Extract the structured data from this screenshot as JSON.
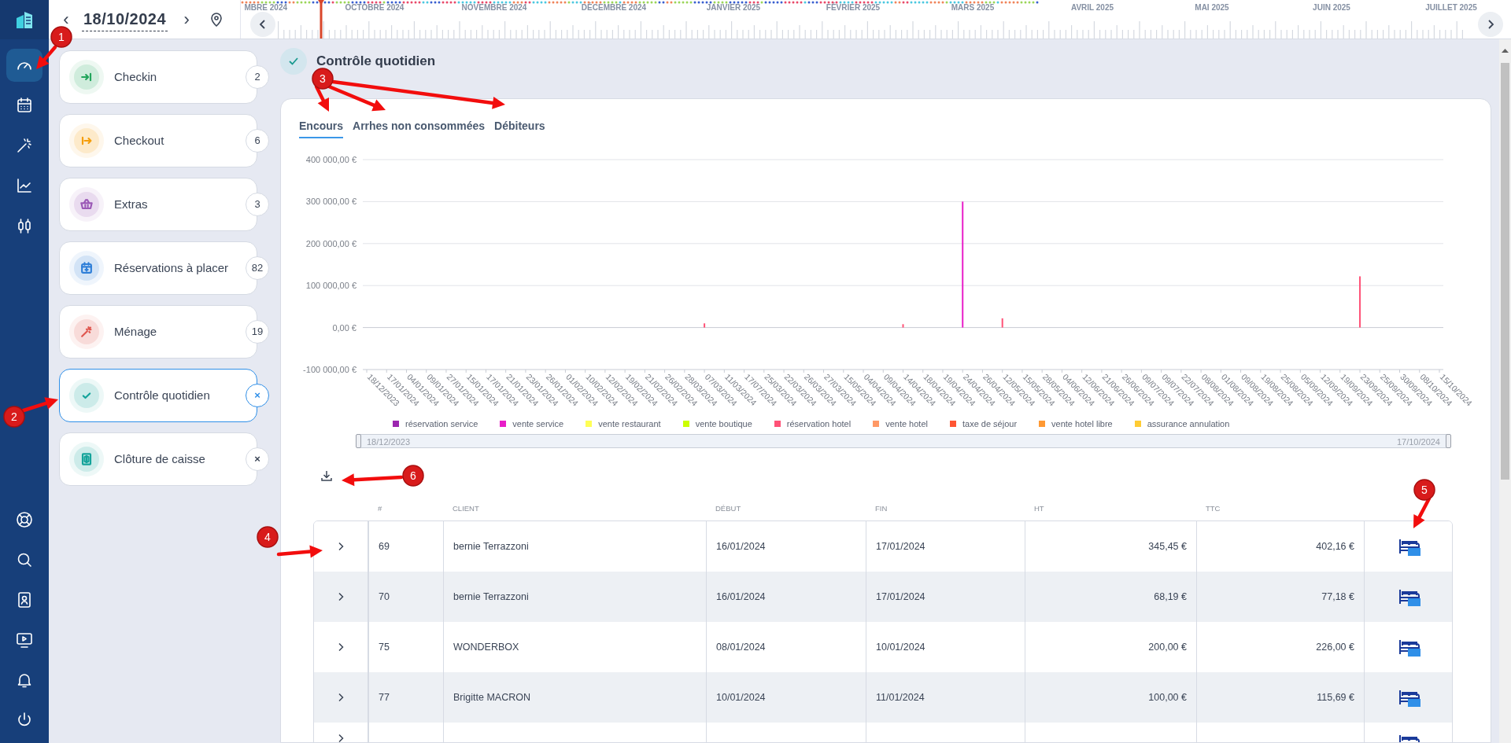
{
  "sidebar": {
    "items": [
      {
        "selected": true
      },
      {
        "selected": false
      },
      {
        "selected": false
      },
      {
        "selected": false
      },
      {
        "selected": false
      }
    ],
    "bottom_items": [
      {
        "selected": false
      },
      {
        "selected": false
      },
      {
        "selected": false
      },
      {
        "selected": false
      },
      {
        "selected": false
      },
      {
        "selected": false
      }
    ]
  },
  "date_nav": {
    "prev": "‹",
    "date": "18/10/2024",
    "next": "›"
  },
  "timeline": {
    "months": [
      "MBRE 2024",
      "OCTOBRE 2024",
      "NOVEMBRE 2024",
      "DÉCEMBRE 2024",
      "JANVIER 2025",
      "FÉVRIER 2025",
      "MARS 2025",
      "AVRIL 2025",
      "MAI 2025",
      "JUIN 2025",
      "JUILLET 2025"
    ]
  },
  "cards": [
    {
      "label": "Checkin",
      "badge": "2",
      "kind": "count",
      "color": "#22a55b",
      "selected": false
    },
    {
      "label": "Checkout",
      "badge": "6",
      "kind": "count",
      "color": "#f59e0b",
      "selected": false
    },
    {
      "label": "Extras",
      "badge": "3",
      "kind": "count",
      "color": "#9b59b6",
      "selected": false
    },
    {
      "label": "Réservations à placer",
      "badge": "82",
      "kind": "count",
      "color": "#2f7fd8",
      "selected": false
    },
    {
      "label": "Ménage",
      "badge": "19",
      "kind": "count",
      "color": "#e0574f",
      "selected": false
    },
    {
      "label": "Contrôle quotidien",
      "badge": "×",
      "kind": "close",
      "color": "#14a39a",
      "selected": true
    },
    {
      "label": "Clôture de caisse",
      "badge": "×",
      "kind": "close",
      "color": "#14a39a",
      "selected": false
    }
  ],
  "page_title": "Contrôle quotidien",
  "tabs": [
    {
      "label": "Encours",
      "selected": true
    },
    {
      "label": "Arrhes non consommées",
      "selected": false
    },
    {
      "label": "Débiteurs",
      "selected": false
    }
  ],
  "chart_data": {
    "type": "bar",
    "stacked": true,
    "grid": true,
    "ylim": [
      -100000,
      400000
    ],
    "yticks": [
      {
        "value": 400000,
        "label": "400 000,00 €"
      },
      {
        "value": 300000,
        "label": "300 000,00 €"
      },
      {
        "value": 200000,
        "label": "200 000,00 €"
      },
      {
        "value": 100000,
        "label": "100 000,00 €"
      },
      {
        "value": 0,
        "label": "0,00 €"
      },
      {
        "value": -100000,
        "label": "-100 000,00 €"
      }
    ],
    "categories": [
      "18/12/2023",
      "17/01/2024",
      "04/01/2024",
      "09/01/2024",
      "27/01/2024",
      "15/01/2024",
      "17/01/2024",
      "21/01/2024",
      "23/01/2024",
      "26/01/2024",
      "01/02/2024",
      "10/02/2024",
      "12/02/2024",
      "19/02/2024",
      "21/02/2024",
      "26/02/2024",
      "28/03/2024",
      "07/03/2024",
      "11/03/2024",
      "17/07/2024",
      "25/03/2024",
      "22/03/2024",
      "26/03/2024",
      "27/03/2024",
      "15/05/2024",
      "04/04/2024",
      "09/04/2024",
      "14/04/2024",
      "18/04/2024",
      "19/04/2024",
      "24/04/2024",
      "26/04/2024",
      "12/05/2024",
      "15/05/2024",
      "28/05/2024",
      "04/06/2024",
      "12/06/2024",
      "21/06/2024",
      "26/06/2024",
      "09/07/2024",
      "09/07/2024",
      "22/07/2024",
      "08/08/2024",
      "01/08/2024",
      "09/08/2024",
      "19/08/2024",
      "25/08/2024",
      "05/09/2024",
      "12/09/2024",
      "19/09/2024",
      "23/09/2024",
      "25/09/2024",
      "30/09/2024",
      "08/10/2024",
      "15/10/2024"
    ],
    "series": [
      {
        "name": "réservation service",
        "color": "#9c27b0",
        "values": [
          null,
          null,
          null,
          null,
          null,
          null,
          null,
          null,
          null,
          null,
          null,
          null,
          null,
          null,
          null,
          null,
          null,
          null,
          null,
          null,
          null,
          null,
          null,
          null,
          null,
          null,
          null,
          null,
          null,
          null,
          null,
          null,
          null,
          null,
          null,
          null,
          null,
          null,
          null,
          null,
          null,
          null,
          null,
          null,
          null,
          null,
          null,
          null,
          null,
          null,
          null,
          null,
          null,
          null,
          null
        ]
      },
      {
        "name": "vente service",
        "color": "#e81ec8",
        "values": [
          null,
          null,
          null,
          null,
          null,
          null,
          null,
          null,
          null,
          null,
          null,
          null,
          null,
          null,
          null,
          null,
          null,
          null,
          null,
          null,
          null,
          null,
          null,
          null,
          null,
          null,
          null,
          null,
          null,
          null,
          300000,
          null,
          null,
          null,
          null,
          null,
          null,
          null,
          null,
          null,
          null,
          null,
          null,
          null,
          null,
          null,
          null,
          null,
          null,
          null,
          null,
          null,
          null,
          null,
          null
        ]
      },
      {
        "name": "vente restaurant",
        "color": "#ffff55",
        "values": [
          null,
          null,
          null,
          null,
          null,
          null,
          null,
          null,
          null,
          null,
          null,
          null,
          null,
          null,
          null,
          null,
          null,
          null,
          null,
          null,
          null,
          null,
          null,
          null,
          null,
          null,
          null,
          null,
          null,
          null,
          null,
          null,
          null,
          null,
          null,
          null,
          null,
          null,
          null,
          null,
          null,
          null,
          null,
          null,
          null,
          null,
          null,
          null,
          null,
          null,
          null,
          null,
          null,
          null,
          null
        ]
      },
      {
        "name": "vente boutique",
        "color": "#ccff00",
        "values": [
          null,
          null,
          null,
          null,
          null,
          null,
          null,
          null,
          null,
          null,
          null,
          null,
          null,
          null,
          null,
          null,
          null,
          null,
          null,
          null,
          null,
          null,
          null,
          null,
          null,
          null,
          null,
          null,
          null,
          null,
          null,
          null,
          null,
          null,
          null,
          null,
          null,
          null,
          null,
          null,
          null,
          null,
          null,
          null,
          null,
          null,
          null,
          null,
          null,
          null,
          null,
          null,
          null,
          null,
          null
        ]
      },
      {
        "name": "réservation hotel",
        "color": "#ff5277",
        "values": [
          null,
          null,
          null,
          null,
          null,
          null,
          null,
          null,
          null,
          null,
          null,
          null,
          null,
          null,
          null,
          null,
          null,
          10000,
          null,
          null,
          null,
          null,
          null,
          null,
          null,
          null,
          null,
          8000,
          null,
          null,
          null,
          null,
          22000,
          null,
          null,
          null,
          null,
          null,
          null,
          null,
          null,
          null,
          null,
          null,
          null,
          null,
          null,
          null,
          null,
          null,
          122000,
          null,
          null,
          null,
          null
        ]
      },
      {
        "name": "vente hotel",
        "color": "#ff9966",
        "values": [
          null,
          null,
          null,
          null,
          null,
          null,
          null,
          null,
          null,
          null,
          null,
          null,
          null,
          null,
          null,
          null,
          null,
          null,
          null,
          null,
          null,
          null,
          null,
          null,
          null,
          null,
          null,
          null,
          null,
          null,
          null,
          null,
          null,
          null,
          null,
          null,
          null,
          null,
          null,
          null,
          null,
          null,
          null,
          null,
          null,
          null,
          null,
          null,
          null,
          null,
          null,
          null,
          null,
          null,
          null
        ]
      },
      {
        "name": "taxe de séjour",
        "color": "#ff5533",
        "values": [
          null,
          null,
          null,
          null,
          null,
          null,
          null,
          null,
          null,
          null,
          null,
          null,
          null,
          null,
          null,
          null,
          null,
          null,
          null,
          null,
          null,
          null,
          null,
          null,
          null,
          null,
          null,
          null,
          null,
          null,
          null,
          null,
          null,
          null,
          null,
          null,
          null,
          null,
          null,
          null,
          null,
          null,
          null,
          null,
          null,
          null,
          null,
          null,
          null,
          null,
          null,
          null,
          null,
          null,
          null
        ]
      },
      {
        "name": "vente hotel libre",
        "color": "#ff9933",
        "values": [
          null,
          null,
          null,
          null,
          null,
          null,
          null,
          null,
          null,
          null,
          null,
          null,
          null,
          null,
          null,
          null,
          null,
          null,
          null,
          null,
          null,
          null,
          null,
          null,
          null,
          null,
          null,
          null,
          null,
          null,
          null,
          null,
          null,
          null,
          null,
          null,
          null,
          null,
          null,
          null,
          null,
          null,
          null,
          null,
          null,
          null,
          null,
          null,
          null,
          null,
          null,
          null,
          null,
          null,
          null
        ]
      },
      {
        "name": "assurance annulation",
        "color": "#ffcc33",
        "values": [
          null,
          null,
          null,
          null,
          null,
          null,
          null,
          null,
          null,
          null,
          null,
          null,
          null,
          null,
          null,
          null,
          null,
          null,
          null,
          null,
          null,
          null,
          null,
          null,
          null,
          null,
          null,
          null,
          null,
          null,
          null,
          null,
          null,
          null,
          null,
          null,
          null,
          null,
          null,
          null,
          null,
          null,
          null,
          null,
          null,
          null,
          null,
          null,
          null,
          null,
          null,
          null,
          null,
          null,
          null
        ]
      }
    ]
  },
  "range": {
    "start": "18/12/2023",
    "end": "17/10/2024",
    "level": 1
  },
  "table": {
    "columns": [
      "#",
      "CLIENT",
      "DÉBUT",
      "FIN",
      "HT",
      "TTC"
    ],
    "rows": [
      {
        "number": "69",
        "client": "bernie Terrazzoni",
        "start": "16/01/2024",
        "end": "17/01/2024",
        "ht": "345,45 €",
        "ttc": "402,16 €"
      },
      {
        "number": "70",
        "client": "bernie Terrazzoni",
        "start": "16/01/2024",
        "end": "17/01/2024",
        "ht": "68,19 €",
        "ttc": "77,18 €"
      },
      {
        "number": "75",
        "client": "WONDERBOX",
        "start": "08/01/2024",
        "end": "10/01/2024",
        "ht": "200,00 €",
        "ttc": "226,00 €"
      },
      {
        "number": "77",
        "client": "Brigitte MACRON",
        "start": "10/01/2024",
        "end": "11/01/2024",
        "ht": "100,00 €",
        "ttc": "115,69 €"
      }
    ],
    "partial_row": true
  },
  "annotations": [
    {
      "number": "1"
    },
    {
      "number": "2"
    },
    {
      "number": "3"
    },
    {
      "number": "4"
    },
    {
      "number": "5"
    },
    {
      "number": "6"
    }
  ]
}
